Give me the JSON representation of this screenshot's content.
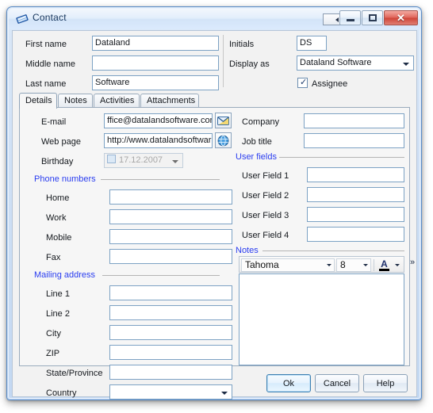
{
  "window": {
    "title": "Contact",
    "icon": "contact-card-icon",
    "collapse_button": "collapse-panel-button",
    "minimize_label": "Minimize",
    "maximize_label": "Maximize",
    "close_label": "Close"
  },
  "header": {
    "fields": [
      {
        "label": "First name",
        "value": "Dataland"
      },
      {
        "label": "Middle name",
        "value": ""
      },
      {
        "label": "Last name",
        "value": "Software"
      }
    ],
    "initials_label": "Initials",
    "initials_value": "DS",
    "display_as_label": "Display as",
    "display_as_value": "Dataland Software",
    "assignee_label": "Assignee",
    "assignee_checked": "✓"
  },
  "tabs": [
    {
      "label": "Details",
      "active": true
    },
    {
      "label": "Notes",
      "active": false
    },
    {
      "label": "Activities",
      "active": false
    },
    {
      "label": "Attachments",
      "active": false
    }
  ],
  "details": {
    "email_label": "E-mail",
    "email_value": "ffice@datalandsoftware.com",
    "email_button_icon": "envelope-icon",
    "web_label": "Web page",
    "web_value": "http://www.datalandsoftware",
    "web_button_icon": "globe-icon",
    "birthday_label": "Birthday",
    "birthday_value": "17.12.2007",
    "birthday_checkbox_icon": "date-checkbox-icon",
    "phone_group": "Phone numbers",
    "phones": [
      {
        "label": "Home",
        "value": ""
      },
      {
        "label": "Work",
        "value": ""
      },
      {
        "label": "Mobile",
        "value": ""
      },
      {
        "label": "Fax",
        "value": ""
      }
    ],
    "address_group": "Mailing address",
    "address": [
      {
        "label": "Line 1",
        "value": "",
        "type": "text"
      },
      {
        "label": "Line 2",
        "value": "",
        "type": "text"
      },
      {
        "label": "City",
        "value": "",
        "type": "text"
      },
      {
        "label": "ZIP",
        "value": "",
        "type": "text"
      },
      {
        "label": "State/Province",
        "value": "",
        "type": "text"
      },
      {
        "label": "Country",
        "value": "",
        "type": "combo"
      }
    ],
    "company_label": "Company",
    "company_value": "",
    "jobtitle_label": "Job title",
    "jobtitle_value": "",
    "userfields_group": "User fields",
    "user_fields": [
      {
        "label": "User Field 1",
        "value": ""
      },
      {
        "label": "User Field 2",
        "value": ""
      },
      {
        "label": "User Field 3",
        "value": ""
      },
      {
        "label": "User Field 4",
        "value": ""
      }
    ],
    "notes_group": "Notes",
    "notes_toolbar": {
      "font_name": "Tahoma",
      "font_size": "8",
      "font_color_icon": "font-color-icon",
      "overflow_icon": "»"
    },
    "notes_text": ""
  },
  "footer": {
    "ok": "Ok",
    "cancel": "Cancel",
    "help": "Help"
  }
}
